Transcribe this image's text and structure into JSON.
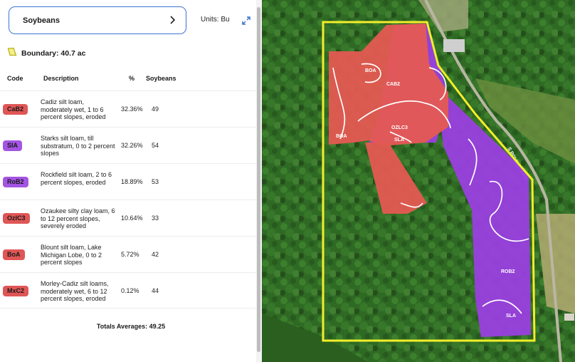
{
  "crop_select": {
    "value": "Soybeans"
  },
  "units_label": "Units: Bu",
  "boundary": {
    "label": "Boundary: 40.7 ac"
  },
  "table": {
    "headers": {
      "code": "Code",
      "description": "Description",
      "percent": "%",
      "yield": "Soybeans"
    },
    "rows": [
      {
        "code": "CaB2",
        "color": "#e05656",
        "description": "Cadiz silt loam, moderately wet, 1 to 6 percent slopes, eroded",
        "percent": "32.36%",
        "yield": "49"
      },
      {
        "code": "SIA",
        "color": "#a455e3",
        "description": "Starks silt loam, till substratum, 0 to 2 percent slopes",
        "percent": "32.26%",
        "yield": "54"
      },
      {
        "code": "RoB2",
        "color": "#a455e3",
        "description": "Rockfield silt loam, 2 to 6 percent slopes, eroded",
        "percent": "18.89%",
        "yield": "53"
      },
      {
        "code": "OzlC3",
        "color": "#e05656",
        "description": "Ozaukee silty clay loam, 6 to 12 percent slopes, severely eroded",
        "percent": "10.64%",
        "yield": "33"
      },
      {
        "code": "BoA",
        "color": "#e05656",
        "description": "Blount silt loam, Lake Michigan Lobe, 0 to 2 percent slopes",
        "percent": "5.72%",
        "yield": "42"
      },
      {
        "code": "MxC2",
        "color": "#e05656",
        "description": "Morley-Cadiz silt loams, moderately wet, 6 to 12 percent slopes, eroded",
        "percent": "0.12%",
        "yield": "44"
      }
    ]
  },
  "totals": "Totals Averages: 49.25",
  "map": {
    "road_label": "S POVERTY RD",
    "zone_labels": [
      "BOA",
      "CAB2",
      "OZLC3",
      "BOA",
      "SLA",
      "ROB2",
      "SLA"
    ],
    "colors": {
      "red_zone": "#e45a52",
      "purple_zone": "#9a3fe0",
      "boundary": "#f2ee2a",
      "accent": "#3d74d4"
    }
  }
}
